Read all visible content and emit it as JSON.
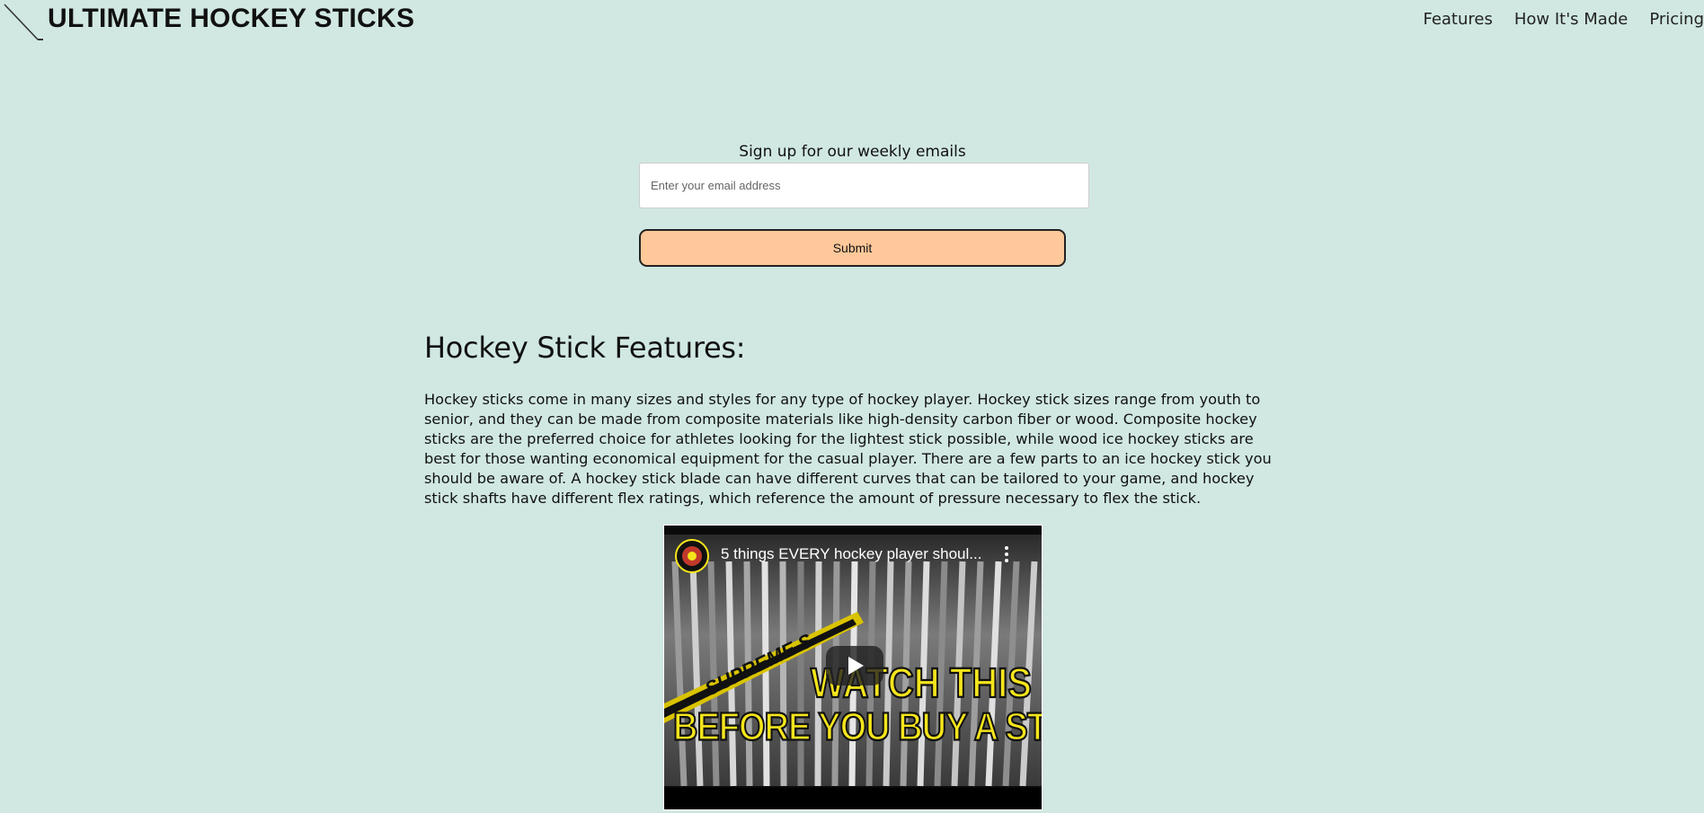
{
  "header": {
    "logo_text": "ULTIMATE HOCKEY STICKS",
    "nav": [
      "Features",
      "How It's Made",
      "Pricing"
    ]
  },
  "signup": {
    "label": "Sign up for our weekly emails",
    "email_placeholder": "Enter your email address",
    "email_value": "",
    "submit_label": "Submit"
  },
  "features": {
    "heading": "Hockey Stick Features:",
    "text": "Hockey sticks come in many sizes and styles for any type of hockey player. Hockey stick sizes range from youth to senior, and they can be made from composite materials like high-density carbon fiber or wood. Composite hockey sticks are the preferred choice for athletes looking for the lightest stick possible, while wood ice hockey sticks are best for those wanting economical equipment for the casual player. There are a few parts to an ice hockey stick you should be aware of. A hockey stick blade can have different curves that can be tailored to your game, and hockey stick shafts have different flex ratings, which reference the amount of pressure necessary to flex the stick."
  },
  "video": {
    "title": "5 things EVERY hockey player shoul...",
    "overlay_line1": "WATCH THIS",
    "overlay_line2": "BEFORE YOU BUY A STICK",
    "stick_brand": "SUPREME S"
  },
  "colors": {
    "background": "#d1e8e2",
    "submit_button": "#fec89a",
    "overlay_text": "#f5e51c"
  },
  "icons": [
    "hockey-stick-icon",
    "channel-avatar-icon",
    "more-options-icon",
    "play-icon"
  ]
}
